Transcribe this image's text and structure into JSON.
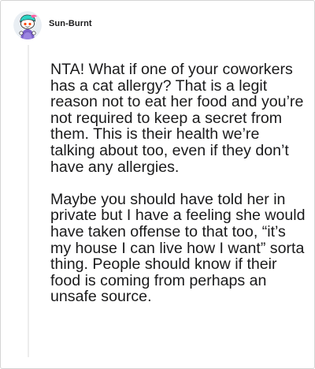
{
  "comment": {
    "username": "Sun-Burnt",
    "avatar_icon": "snoo-avatar-icon",
    "paragraphs": [
      "NTA! What if one of your coworkers has a cat allergy? That is a legit reason not to eat her food and you’re not required to keep a secret from them. This is their health we’re talking about too, even if they don’t have any allergies.",
      "Maybe you should have told her in private but I have a feeling she would have taken offense to that too, “it’s my house I can live how I want” sorta thing. People should know if their food is coming from perhaps an unsafe source."
    ]
  },
  "colors": {
    "text": "#1a1a1b",
    "border": "#d4d4d4",
    "thread_line": "#ededed",
    "avatar_accent": "#2dd4c4",
    "avatar_purple": "#7b61c9"
  }
}
